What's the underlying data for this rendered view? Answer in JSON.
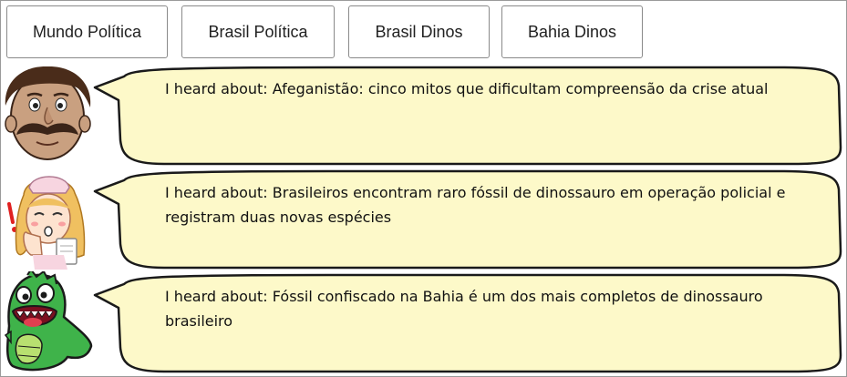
{
  "tabs": [
    {
      "label": "Mundo Política"
    },
    {
      "label": "Brasil Política"
    },
    {
      "label": "Brasil Dinos"
    },
    {
      "label": "Bahia Dinos"
    }
  ],
  "messages": [
    {
      "avatar": "mustache-man-icon",
      "text": "I heard about: Afeganistão: cinco mitos que dificultam compreensão da crise atual"
    },
    {
      "avatar": "nurse-icon",
      "text": "I heard about: Brasileiros encontram raro fóssil de dinossauro em operação policial e registram duas novas espécies"
    },
    {
      "avatar": "green-dinosaur-icon",
      "text": "I heard about: Fóssil confiscado na Bahia é um dos mais completos de dinossauro brasileiro"
    }
  ],
  "colors": {
    "bubble_fill": "#fdf9c9",
    "bubble_stroke": "#1a1a1a",
    "dino_green": "#3fb34a"
  }
}
